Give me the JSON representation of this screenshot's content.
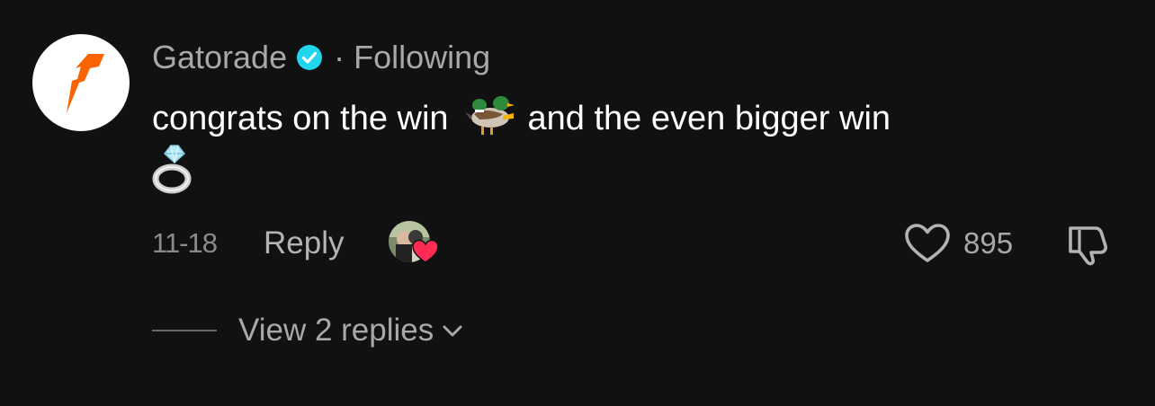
{
  "comment": {
    "author": "Gatorade",
    "separator": "·",
    "follow_status": "Following",
    "text_part1": "congrats on the win",
    "text_part2": "and the even bigger win",
    "emoji1": "duck-emoji",
    "emoji2": "ring-emoji",
    "date": "11-18",
    "reply_label": "Reply",
    "like_count": "895",
    "view_replies_label": "View 2 replies"
  },
  "colors": {
    "background": "#111111",
    "text_primary": "#ffffff",
    "text_secondary": "#a8a8a8",
    "verified_blue": "#20d5ec",
    "heart_red": "#fe2c55",
    "brand_orange": "#f96302"
  },
  "icons": {
    "avatar": "gatorade-bolt-logo",
    "verified": "verified-badge-icon",
    "like": "heart-outline-icon",
    "dislike": "thumbs-down-icon",
    "creator_liked": "creator-liked-heart-icon",
    "expand": "chevron-down-icon"
  }
}
